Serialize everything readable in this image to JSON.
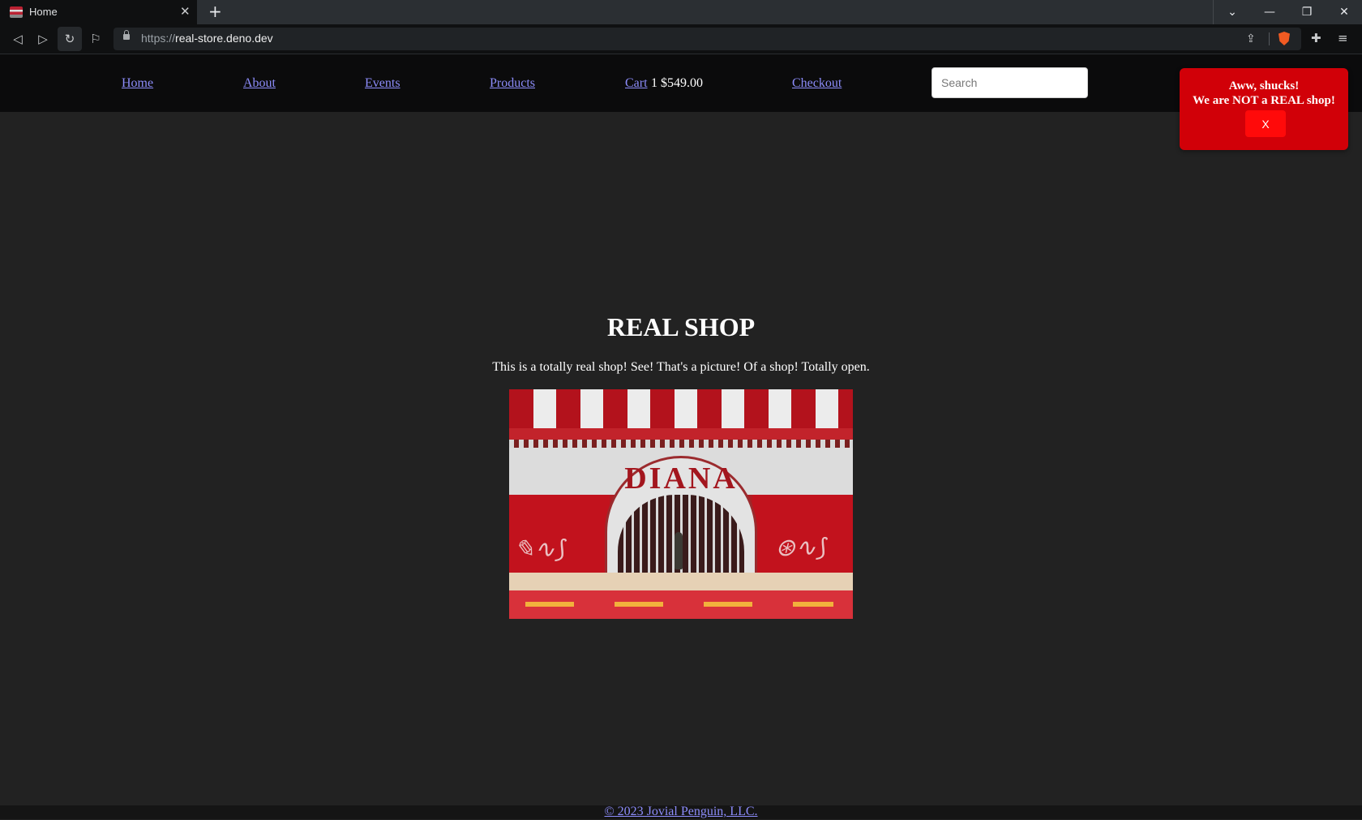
{
  "browser": {
    "tab": {
      "title": "Home"
    },
    "address": {
      "scheme": "https://",
      "host": "real-store.deno.dev"
    }
  },
  "nav": {
    "home": "Home",
    "about": "About",
    "events": "Events",
    "products": "Products",
    "cart": "Cart",
    "cart_count": "1",
    "cart_total": "$549.00",
    "checkout": "Checkout"
  },
  "search": {
    "placeholder": "Search"
  },
  "toast": {
    "line1": "Aww, shucks!",
    "line2": "We are NOT a REAL shop!",
    "close_label": "X"
  },
  "main": {
    "title": "REAL SHOP",
    "description": "This is a totally real shop! See! That's a picture! Of a shop! Totally open.",
    "image_sign": "DIANA"
  },
  "footer": {
    "link": "© 2023 Jovial Penguin, LLC."
  },
  "colors": {
    "link": "#8c8cfa",
    "toast_bg": "#d10008",
    "toast_button": "#ff0a0a",
    "page_bg": "#222222",
    "nav_bg": "#0b0b0c"
  }
}
